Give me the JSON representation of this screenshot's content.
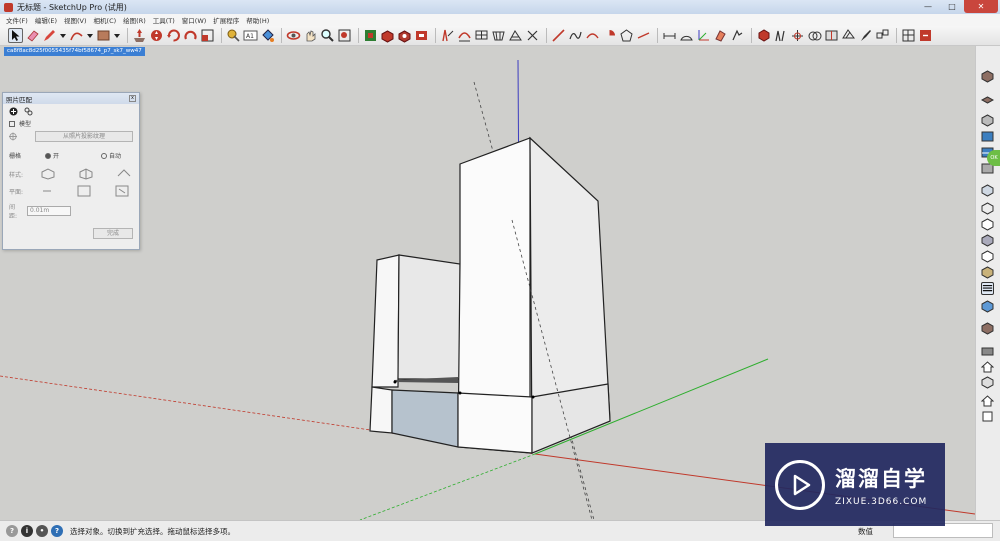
{
  "window": {
    "title": "无标题 - SketchUp Pro (试用)",
    "buttons": [
      "—",
      "□",
      "✕"
    ]
  },
  "menubar": {
    "items": [
      "文件(F)",
      "编辑(E)",
      "视图(V)",
      "相机(C)",
      "绘图(R)",
      "工具(T)",
      "窗口(W)",
      "扩展程序",
      "帮助(H)"
    ]
  },
  "toolbar": {
    "icons": [
      "select-icon",
      "eraser-icon",
      "pencil-icon",
      "dropdown-icon",
      "arc-icon",
      "dropdown-icon",
      "rectangle-icon",
      "dropdown-icon",
      "push-pull-icon",
      "rotate-icon",
      "scale-icon",
      "follow-me-icon",
      "offset-icon",
      "tape-measure-icon",
      "text-icon",
      "paint-bucket-icon",
      "orbit-icon",
      "pan-icon",
      "zoom-icon",
      "zoom-extents-icon",
      "components-icon",
      "warehouse-icon",
      "extension-icon",
      "share-icon",
      "layers-icon",
      "sandbox-icon",
      "solid-tools-icon",
      "section-icon"
    ]
  },
  "viewport": {
    "scene_tab": "ca8f8ac8d25f0055435f74bf58674_p7_sk7_ww47"
  },
  "photo_match": {
    "title": "照片匹配",
    "close": "x",
    "model_checkbox_label": "模型",
    "project_button": "从照片投影纹理",
    "grid_label": "栅格",
    "grid_on": "开",
    "grid_auto": "自动",
    "style_label": "样式:",
    "plane_label": "平面:",
    "spacing_label": "间距:",
    "spacing_value": "0.01m",
    "done_button": "完成"
  },
  "statusbar": {
    "message": "选择对象。切换到扩充选择。拖动鼠标选择多项。",
    "measurements_label": "数值",
    "measurements_value": ""
  },
  "watermark": {
    "text": "溜溜自学",
    "url": "ZIXUE.3D66.COM"
  },
  "colors": {
    "viewport_bg": "#cfcfcc",
    "accent_blue": "#3b7fd4",
    "axis_red": "#c0392b",
    "axis_green": "#2eae2e",
    "axis_blue": "#3c3cbf",
    "watermark_bg": "#22285f"
  }
}
